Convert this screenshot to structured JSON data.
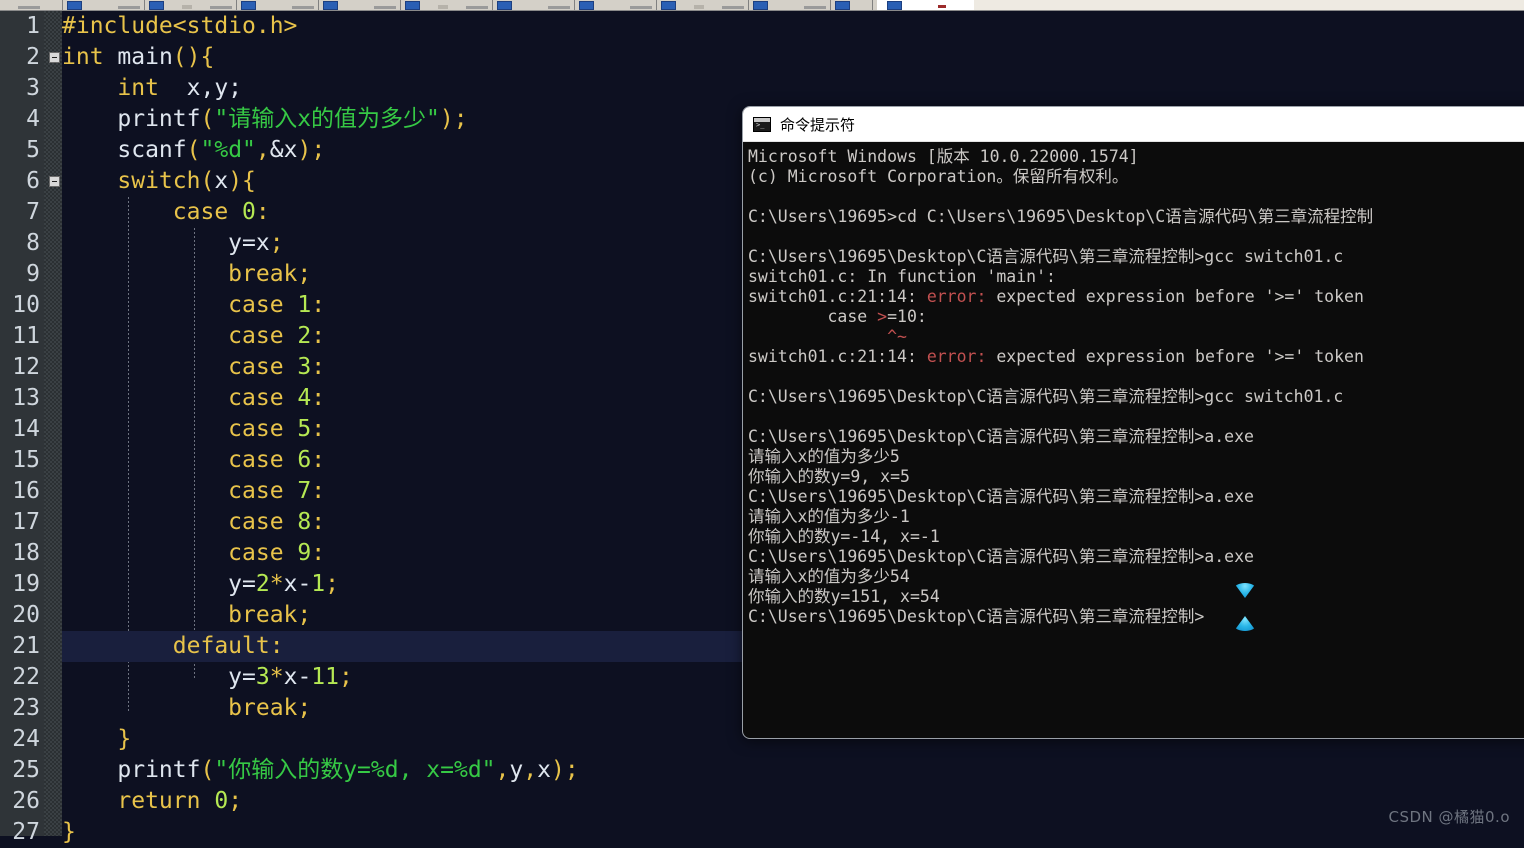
{
  "toolbar": {
    "description": "cut-off application toolbar strip at top of screen",
    "group_count": 12
  },
  "editor": {
    "window_name": "code-editor",
    "highlighted_line": 21,
    "first_line": 1,
    "last_visible_line": 27,
    "colors": {
      "background": "#0d1021",
      "gutter": "#2f3438",
      "highlight_line": "#191f3d",
      "keyword": "#e8c34a",
      "string": "#36c945",
      "number": "#b5e853",
      "plain": "#dfe6ef"
    },
    "lines": [
      {
        "num": "1",
        "fold": false,
        "indent": 0,
        "tokens": [
          {
            "t": "#include<stdio.h>",
            "c": "t-pre"
          }
        ]
      },
      {
        "num": "2",
        "fold": true,
        "indent": 0,
        "tokens": [
          {
            "t": "int",
            "c": "t-kw"
          },
          {
            "t": " ",
            "c": "t-plain"
          },
          {
            "t": "main",
            "c": "t-plain"
          },
          {
            "t": "(){",
            "c": "t-punc"
          }
        ]
      },
      {
        "num": "3",
        "fold": false,
        "indent": 0,
        "tokens": [
          {
            "t": "    ",
            "c": "t-plain"
          },
          {
            "t": "int",
            "c": "t-kw"
          },
          {
            "t": "  x,y;",
            "c": "t-plain"
          }
        ]
      },
      {
        "num": "4",
        "fold": false,
        "indent": 0,
        "tokens": [
          {
            "t": "    ",
            "c": "t-plain"
          },
          {
            "t": "printf",
            "c": "t-plain"
          },
          {
            "t": "(",
            "c": "t-punc"
          },
          {
            "t": "\"请输入x的值为多少\"",
            "c": "t-str"
          },
          {
            "t": ")",
            "c": "t-punc"
          },
          {
            "t": ";",
            "c": "t-punc"
          }
        ]
      },
      {
        "num": "5",
        "fold": false,
        "indent": 0,
        "tokens": [
          {
            "t": "    ",
            "c": "t-plain"
          },
          {
            "t": "scanf",
            "c": "t-plain"
          },
          {
            "t": "(",
            "c": "t-punc"
          },
          {
            "t": "\"%d\"",
            "c": "t-str"
          },
          {
            "t": ",",
            "c": "t-punc"
          },
          {
            "t": "&x",
            "c": "t-plain"
          },
          {
            "t": ")",
            "c": "t-punc"
          },
          {
            "t": ";",
            "c": "t-punc"
          }
        ]
      },
      {
        "num": "6",
        "fold": true,
        "indent": 0,
        "tokens": [
          {
            "t": "    ",
            "c": "t-plain"
          },
          {
            "t": "switch",
            "c": "t-kw"
          },
          {
            "t": "(",
            "c": "t-punc"
          },
          {
            "t": "x",
            "c": "t-plain"
          },
          {
            "t": "){",
            "c": "t-punc"
          }
        ]
      },
      {
        "num": "7",
        "fold": false,
        "indent": 0,
        "tokens": [
          {
            "t": "        ",
            "c": "t-plain"
          },
          {
            "t": "case",
            "c": "t-kw"
          },
          {
            "t": " ",
            "c": "t-plain"
          },
          {
            "t": "0",
            "c": "t-num"
          },
          {
            "t": ":",
            "c": "t-punc"
          }
        ]
      },
      {
        "num": "8",
        "fold": false,
        "indent": 0,
        "tokens": [
          {
            "t": "            ",
            "c": "t-plain"
          },
          {
            "t": "y=x",
            "c": "t-plain"
          },
          {
            "t": ";",
            "c": "t-punc"
          }
        ]
      },
      {
        "num": "9",
        "fold": false,
        "indent": 0,
        "tokens": [
          {
            "t": "            ",
            "c": "t-plain"
          },
          {
            "t": "break",
            "c": "t-kw"
          },
          {
            "t": ";",
            "c": "t-punc"
          }
        ]
      },
      {
        "num": "10",
        "fold": false,
        "indent": 0,
        "tokens": [
          {
            "t": "            ",
            "c": "t-plain"
          },
          {
            "t": "case",
            "c": "t-kw"
          },
          {
            "t": " ",
            "c": "t-plain"
          },
          {
            "t": "1",
            "c": "t-num"
          },
          {
            "t": ":",
            "c": "t-punc"
          }
        ]
      },
      {
        "num": "11",
        "fold": false,
        "indent": 0,
        "tokens": [
          {
            "t": "            ",
            "c": "t-plain"
          },
          {
            "t": "case",
            "c": "t-kw"
          },
          {
            "t": " ",
            "c": "t-plain"
          },
          {
            "t": "2",
            "c": "t-num"
          },
          {
            "t": ":",
            "c": "t-punc"
          }
        ]
      },
      {
        "num": "12",
        "fold": false,
        "indent": 0,
        "tokens": [
          {
            "t": "            ",
            "c": "t-plain"
          },
          {
            "t": "case",
            "c": "t-kw"
          },
          {
            "t": " ",
            "c": "t-plain"
          },
          {
            "t": "3",
            "c": "t-num"
          },
          {
            "t": ":",
            "c": "t-punc"
          }
        ]
      },
      {
        "num": "13",
        "fold": false,
        "indent": 0,
        "tokens": [
          {
            "t": "            ",
            "c": "t-plain"
          },
          {
            "t": "case",
            "c": "t-kw"
          },
          {
            "t": " ",
            "c": "t-plain"
          },
          {
            "t": "4",
            "c": "t-num"
          },
          {
            "t": ":",
            "c": "t-punc"
          }
        ]
      },
      {
        "num": "14",
        "fold": false,
        "indent": 0,
        "tokens": [
          {
            "t": "            ",
            "c": "t-plain"
          },
          {
            "t": "case",
            "c": "t-kw"
          },
          {
            "t": " ",
            "c": "t-plain"
          },
          {
            "t": "5",
            "c": "t-num"
          },
          {
            "t": ":",
            "c": "t-punc"
          }
        ]
      },
      {
        "num": "15",
        "fold": false,
        "indent": 0,
        "tokens": [
          {
            "t": "            ",
            "c": "t-plain"
          },
          {
            "t": "case",
            "c": "t-kw"
          },
          {
            "t": " ",
            "c": "t-plain"
          },
          {
            "t": "6",
            "c": "t-num"
          },
          {
            "t": ":",
            "c": "t-punc"
          }
        ]
      },
      {
        "num": "16",
        "fold": false,
        "indent": 0,
        "tokens": [
          {
            "t": "            ",
            "c": "t-plain"
          },
          {
            "t": "case",
            "c": "t-kw"
          },
          {
            "t": " ",
            "c": "t-plain"
          },
          {
            "t": "7",
            "c": "t-num"
          },
          {
            "t": ":",
            "c": "t-punc"
          }
        ]
      },
      {
        "num": "17",
        "fold": false,
        "indent": 0,
        "tokens": [
          {
            "t": "            ",
            "c": "t-plain"
          },
          {
            "t": "case",
            "c": "t-kw"
          },
          {
            "t": " ",
            "c": "t-plain"
          },
          {
            "t": "8",
            "c": "t-num"
          },
          {
            "t": ":",
            "c": "t-punc"
          }
        ]
      },
      {
        "num": "18",
        "fold": false,
        "indent": 0,
        "tokens": [
          {
            "t": "            ",
            "c": "t-plain"
          },
          {
            "t": "case",
            "c": "t-kw"
          },
          {
            "t": " ",
            "c": "t-plain"
          },
          {
            "t": "9",
            "c": "t-num"
          },
          {
            "t": ":",
            "c": "t-punc"
          }
        ]
      },
      {
        "num": "19",
        "fold": false,
        "indent": 0,
        "tokens": [
          {
            "t": "            ",
            "c": "t-plain"
          },
          {
            "t": "y=",
            "c": "t-plain"
          },
          {
            "t": "2",
            "c": "t-num"
          },
          {
            "t": "*",
            "c": "t-punc"
          },
          {
            "t": "x-",
            "c": "t-plain"
          },
          {
            "t": "1",
            "c": "t-num"
          },
          {
            "t": ";",
            "c": "t-punc"
          }
        ]
      },
      {
        "num": "20",
        "fold": false,
        "indent": 0,
        "tokens": [
          {
            "t": "            ",
            "c": "t-plain"
          },
          {
            "t": "break",
            "c": "t-kw"
          },
          {
            "t": ";",
            "c": "t-punc"
          }
        ]
      },
      {
        "num": "21",
        "fold": false,
        "indent": 0,
        "tokens": [
          {
            "t": "        ",
            "c": "t-plain"
          },
          {
            "t": "default",
            "c": "t-kw"
          },
          {
            "t": ":",
            "c": "t-punc"
          }
        ]
      },
      {
        "num": "22",
        "fold": false,
        "indent": 0,
        "tokens": [
          {
            "t": "            ",
            "c": "t-plain"
          },
          {
            "t": "y=",
            "c": "t-plain"
          },
          {
            "t": "3",
            "c": "t-num"
          },
          {
            "t": "*",
            "c": "t-punc"
          },
          {
            "t": "x-",
            "c": "t-plain"
          },
          {
            "t": "11",
            "c": "t-num"
          },
          {
            "t": ";",
            "c": "t-punc"
          }
        ]
      },
      {
        "num": "23",
        "fold": false,
        "indent": 0,
        "tokens": [
          {
            "t": "            ",
            "c": "t-plain"
          },
          {
            "t": "break",
            "c": "t-kw"
          },
          {
            "t": ";",
            "c": "t-punc"
          }
        ]
      },
      {
        "num": "24",
        "fold": false,
        "indent": 0,
        "tokens": [
          {
            "t": "    ",
            "c": "t-plain"
          },
          {
            "t": "}",
            "c": "t-punc"
          }
        ]
      },
      {
        "num": "25",
        "fold": false,
        "indent": 0,
        "tokens": [
          {
            "t": "    ",
            "c": "t-plain"
          },
          {
            "t": "printf",
            "c": "t-plain"
          },
          {
            "t": "(",
            "c": "t-punc"
          },
          {
            "t": "\"你输入的数y=%d, x=%d\"",
            "c": "t-str"
          },
          {
            "t": ",",
            "c": "t-punc"
          },
          {
            "t": "y",
            "c": "t-plain"
          },
          {
            "t": ",",
            "c": "t-punc"
          },
          {
            "t": "x",
            "c": "t-plain"
          },
          {
            "t": ")",
            "c": "t-punc"
          },
          {
            "t": ";",
            "c": "t-punc"
          }
        ]
      },
      {
        "num": "26",
        "fold": false,
        "indent": 0,
        "tokens": [
          {
            "t": "    ",
            "c": "t-plain"
          },
          {
            "t": "return",
            "c": "t-kw"
          },
          {
            "t": " ",
            "c": "t-plain"
          },
          {
            "t": "0",
            "c": "t-num"
          },
          {
            "t": ";",
            "c": "t-punc"
          }
        ]
      },
      {
        "num": "27",
        "fold": false,
        "indent": 0,
        "tokens": [
          {
            "t": "}",
            "c": "t-punc"
          }
        ]
      }
    ]
  },
  "cmd_window": {
    "title": "命令提示符",
    "icon": "command-prompt-icon",
    "output": [
      {
        "segments": [
          {
            "t": "Microsoft Windows [版本 10.0.22000.1574]"
          }
        ]
      },
      {
        "segments": [
          {
            "t": "(c) Microsoft Corporation。保留所有权利。"
          }
        ]
      },
      {
        "segments": [
          {
            "t": ""
          }
        ]
      },
      {
        "segments": [
          {
            "t": "C:\\Users\\19695>cd C:\\Users\\19695\\Desktop\\C语言源代码\\第三章流程控制"
          }
        ]
      },
      {
        "segments": [
          {
            "t": ""
          }
        ]
      },
      {
        "segments": [
          {
            "t": "C:\\Users\\19695\\Desktop\\C语言源代码\\第三章流程控制>gcc switch01.c"
          }
        ]
      },
      {
        "segments": [
          {
            "t": "switch01.c: In function 'main':"
          }
        ]
      },
      {
        "segments": [
          {
            "t": "switch01.c:21:14: "
          },
          {
            "t": "error:",
            "c": "err"
          },
          {
            "t": " expected expression before '>=' token"
          }
        ]
      },
      {
        "segments": [
          {
            "t": "        case "
          },
          {
            "t": ">",
            "c": "err"
          },
          {
            "t": "=10:"
          }
        ]
      },
      {
        "segments": [
          {
            "t": "              "
          },
          {
            "t": "^~",
            "c": "caret"
          }
        ]
      },
      {
        "segments": [
          {
            "t": "switch01.c:21:14: "
          },
          {
            "t": "error:",
            "c": "err"
          },
          {
            "t": " expected expression before '>=' token"
          }
        ]
      },
      {
        "segments": [
          {
            "t": ""
          }
        ]
      },
      {
        "segments": [
          {
            "t": "C:\\Users\\19695\\Desktop\\C语言源代码\\第三章流程控制>gcc switch01.c"
          }
        ]
      },
      {
        "segments": [
          {
            "t": ""
          }
        ]
      },
      {
        "segments": [
          {
            "t": "C:\\Users\\19695\\Desktop\\C语言源代码\\第三章流程控制>a.exe"
          }
        ]
      },
      {
        "segments": [
          {
            "t": "请输入x的值为多少5"
          }
        ]
      },
      {
        "segments": [
          {
            "t": "你输入的数y=9, x=5"
          }
        ]
      },
      {
        "segments": [
          {
            "t": "C:\\Users\\19695\\Desktop\\C语言源代码\\第三章流程控制>a.exe"
          }
        ]
      },
      {
        "segments": [
          {
            "t": "请输入x的值为多少-1"
          }
        ]
      },
      {
        "segments": [
          {
            "t": "你输入的数y=-14, x=-1"
          }
        ]
      },
      {
        "segments": [
          {
            "t": "C:\\Users\\19695\\Desktop\\C语言源代码\\第三章流程控制>a.exe"
          }
        ]
      },
      {
        "segments": [
          {
            "t": "请输入x的值为多少54"
          }
        ]
      },
      {
        "segments": [
          {
            "t": "你输入的数y=151, x=54"
          }
        ]
      },
      {
        "segments": [
          {
            "t": "C:\\Users\\19695\\Desktop\\C语言源代码\\第三章流程控制>"
          }
        ]
      }
    ]
  },
  "cursor": {
    "type": "busy-working-cursor"
  },
  "watermark": {
    "text": "CSDN @橘猫0.o"
  }
}
